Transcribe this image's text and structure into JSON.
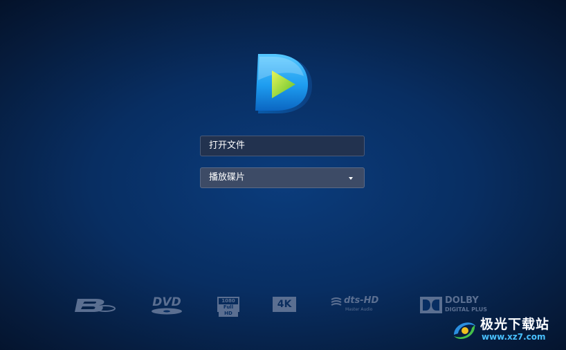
{
  "buttons": {
    "open_file": "打开文件",
    "play_disc": "播放碟片"
  },
  "formats": {
    "bluray_icon": "bluray-logo",
    "dvd": "DVD",
    "fullhd_top": "1080",
    "fullhd_bottom": "Full HD",
    "uhd": "4K",
    "dts_main": "dts-HD",
    "dts_sub": "Master Audio",
    "dolby_main": "DOLBY",
    "dolby_sub": "DIGITAL PLUS"
  },
  "watermark": {
    "title": "极光下载站",
    "url": "www.xz7.com"
  },
  "colors": {
    "accent": "#1e9df0",
    "background": "#0b3c7c",
    "format_logo": "#5b6f91",
    "watermark_url": "#49c0ff"
  }
}
